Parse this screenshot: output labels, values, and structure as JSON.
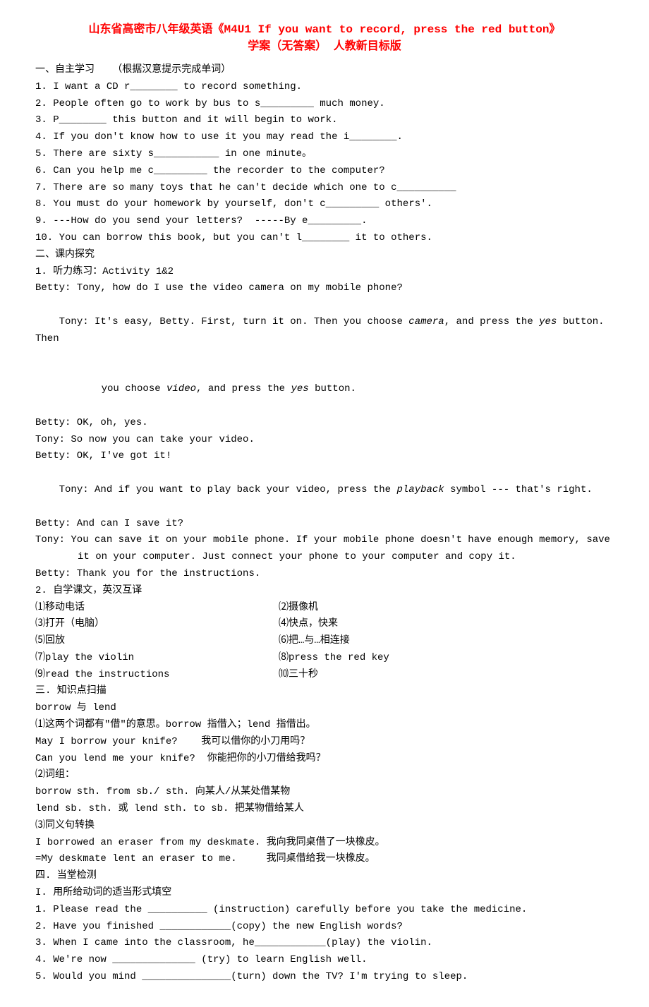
{
  "title_line1": "山东省高密市八年级英语《M4U1 If you want to record, press the red button》",
  "title_line2": "学案（无答案） 人教新目标版",
  "sec1_header": "一、自主学习   （根据汉意提示完成单词）",
  "sec1": {
    "q1": "1. I want a CD r________ to record something.",
    "q2": "2. People often go to work by bus to s_________ much money.",
    "q3": "3. P________ this button and it will begin to work.",
    "q4": "4. If you don't know how to use it you may read the i________.",
    "q5": "5. There are sixty s___________ in one minute。",
    "q6": "6. Can you help me c_________ the recorder to the computer?",
    "q7": "7. There are so many toys that he can't decide which one to c__________",
    "q8": "8. You must do your homework by yourself, don't c_________ others'.",
    "q9": "9. ---How do you send your letters?  -----By e_________.",
    "q10": "10. You can borrow this book, but you can't l________ it to others."
  },
  "sec2_header": "二、课内探究",
  "sec2": {
    "listen": "1. 听力练习：Activity 1&2",
    "betty1": "Betty: Tony, how do I use the video camera on my mobile phone?",
    "tony1a": "Tony: It's easy, Betty. First, turn it on. Then you choose ",
    "tony1_camera": "camera",
    "tony1b": ", and press the ",
    "tony1_yes1": "yes",
    "tony1c": " button. Then",
    "tony1d": "you choose ",
    "tony1_video": "video",
    "tony1e": ", and press the ",
    "tony1_yes2": "yes",
    "tony1f": " button.",
    "betty2": "Betty: OK, oh, yes.",
    "tony2": "Tony: So now you can take your video.",
    "betty3": "Betty: OK, I've got it!",
    "tony3a": "Tony: And if you want to play back your video, press the ",
    "tony3_playback": "playback",
    "tony3b": " symbol --- that's right.",
    "betty4": "Betty: And can I save it?",
    "tony4a": "Tony: You can save it on your mobile phone. If your mobile phone doesn't have enough memory, save",
    "tony4b": "it on your computer. Just connect your phone to your computer and copy it.",
    "betty5": "Betty: Thank you for the instructions.",
    "self_study": "2. 自学课文，英汉互译",
    "trans": {
      "l1": "⑴移动电话",
      "r1": "⑵摄像机",
      "l2": "⑶打开（电脑）",
      "r2": "⑷快点，快来",
      "l3": "⑸回放",
      "r3": "⑹把…与…相连接",
      "l4": "⑺play the violin",
      "r4": "⑻press the red key",
      "l5": "⑼read the instructions",
      "r5": "⑽三十秒"
    }
  },
  "sec3_header": "三. 知识点扫描",
  "sec3": {
    "p1": "borrow 与 lend",
    "p2": "⑴这两个词都有\"借\"的意思。borrow 指借入；lend 指借出。",
    "p3": "May I borrow your knife?    我可以借你的小刀用吗？",
    "p4": "Can you lend me your knife?  你能把你的小刀借给我吗？",
    "p5": "⑵词组：",
    "p6": "borrow sth. from sb./ sth. 向某人/从某处借某物",
    "p7": "lend sb. sth. 或 lend sth. to sb. 把某物借给某人",
    "p8": "⑶同义句转换",
    "p9": "I borrowed an eraser from my deskmate. 我向我同桌借了一块橡皮。",
    "p10": "=My deskmate lent an eraser to me.     我同桌借给我一块橡皮。"
  },
  "sec4_header": "四. 当堂检测",
  "sec4": {
    "sub": "I. 用所给动词的适当形式填空",
    "q1": "1. Please read the __________ (instruction) carefully before you take the medicine.",
    "q2": "2. Have you finished ____________(copy) the new English words?",
    "q3": "3. When I came into the classroom, he____________(play) the violin.",
    "q4": "4. We're now ______________ (try) to learn English well.",
    "q5": "5. Would you mind _______________(turn) down the TV? I'm trying to sleep."
  }
}
